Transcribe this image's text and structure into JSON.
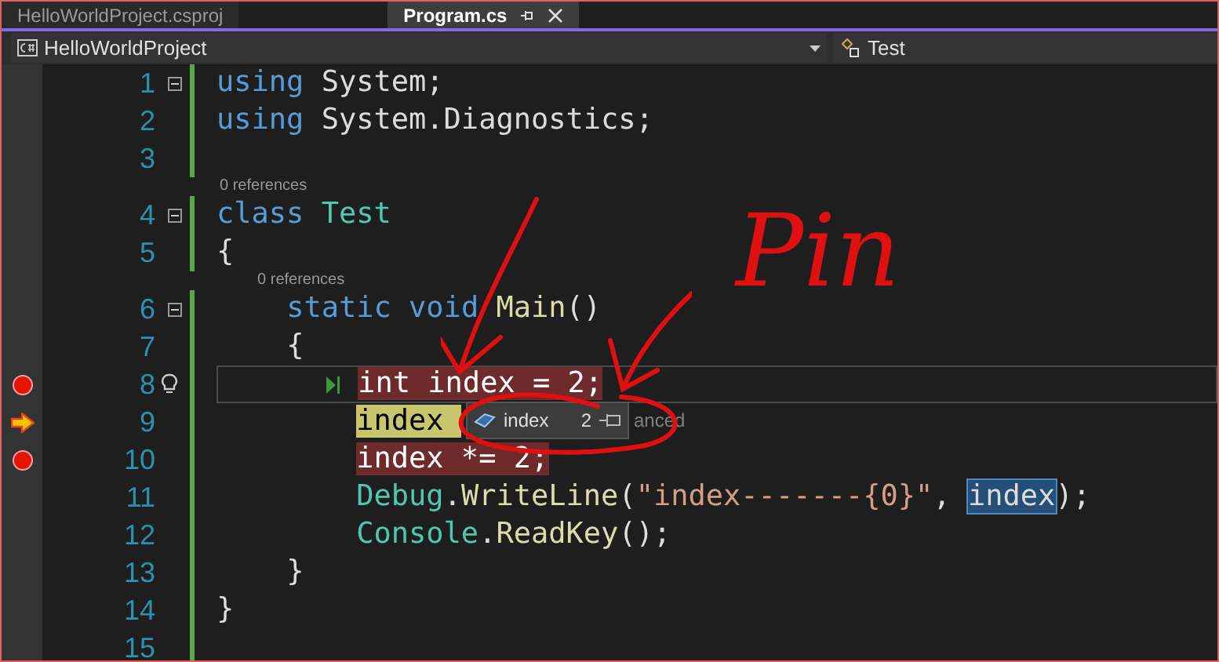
{
  "tabs": [
    {
      "label": "HelloWorldProject.csproj",
      "selected": false
    },
    {
      "label": "Program.cs",
      "selected": true
    }
  ],
  "nav_bar": {
    "project": "HelloWorldProject",
    "member": "Test"
  },
  "lines": [
    {
      "number": "1",
      "fold": true,
      "tokens": [
        {
          "text": "using ",
          "kind": "keyword"
        },
        {
          "text": "System;",
          "kind": "plain"
        }
      ]
    },
    {
      "number": "2",
      "tokens": [
        {
          "text": "using ",
          "kind": "keyword"
        },
        {
          "text": "System.Diagnostics;",
          "kind": "plain"
        }
      ]
    },
    {
      "number": "3"
    },
    {
      "number": "4",
      "codelens": "0 references",
      "fold": true,
      "tokens": [
        {
          "text": "class ",
          "kind": "keyword"
        },
        {
          "text": "Test",
          "kind": "type"
        }
      ]
    },
    {
      "number": "5",
      "tokens": [
        {
          "text": "{",
          "kind": "plain"
        }
      ],
      "children": [
        {
          "number": "6",
          "codelens": "0 references",
          "fold": true,
          "tokens": [
            {
              "text": "static ",
              "kind": "keyword"
            },
            {
              "text": "void ",
              "kind": "keyword"
            },
            {
              "text": "Main",
              "kind": "method"
            },
            {
              "text": "()",
              "kind": "plain"
            }
          ]
        },
        {
          "number": "7",
          "tokens": [
            {
              "text": "{",
              "kind": "plain"
            }
          ],
          "children": [
            {
              "number": "8",
              "breakpoint": true,
              "current_line": true,
              "tokens": [
                {
                  "text": "int index = 2;"
                }
              ]
            },
            {
              "number": "9",
              "current_statement": true,
              "tokens": [
                {
                  "text": "index"
                }
              ]
            },
            {
              "number": "10",
              "breakpoint": true,
              "tokens": [
                {
                  "text": "index *= 2;"
                }
              ]
            },
            {
              "number": "11",
              "tokens": [
                {
                  "text": "Debug",
                  "kind": "type"
                },
                {
                  "text": ".",
                  "kind": "plain"
                },
                {
                  "text": "WriteLine",
                  "kind": "method"
                },
                {
                  "text": "(",
                  "kind": "plain"
                },
                {
                  "text": "\"index-------{0}\"",
                  "kind": "string"
                },
                {
                  "text": ", ",
                  "kind": "plain"
                },
                {
                  "text": "index",
                  "kind": "selected"
                },
                {
                  "text": ");",
                  "kind": "plain"
                }
              ]
            },
            {
              "number": "12",
              "tokens": [
                {
                  "text": "Console",
                  "kind": "type"
                },
                {
                  "text": ".",
                  "kind": "plain"
                },
                {
                  "text": "ReadKey",
                  "kind": "method"
                },
                {
                  "text": "();",
                  "kind": "plain"
                }
              ]
            }
          ]
        },
        {
          "number": "13",
          "tokens": [
            {
              "text": "}",
              "kind": "plain"
            }
          ]
        }
      ]
    },
    {
      "number": "14",
      "tokens": [
        {
          "text": "}",
          "kind": "plain"
        }
      ]
    },
    {
      "number": "15"
    }
  ],
  "datatip": {
    "name": "index",
    "value": "2",
    "trailing_text": "anced"
  },
  "annotation": {
    "text": "Pin"
  }
}
